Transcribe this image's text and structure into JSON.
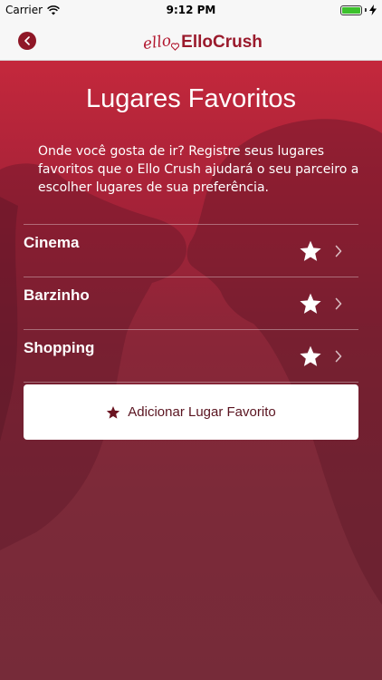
{
  "status_bar": {
    "carrier": "Carrier",
    "time": "9:12 PM"
  },
  "nav": {
    "logo_script": "ello",
    "logo_brand": "ElloCrush"
  },
  "page": {
    "title": "Lugares Favoritos",
    "description": "Onde você gosta de ir? Registre seus lugares favoritos que o Ello Crush ajudará o seu parceiro a escolher lugares de sua preferência."
  },
  "places": [
    {
      "label": "Cinema"
    },
    {
      "label": "Barzinho"
    },
    {
      "label": "Shopping"
    }
  ],
  "add_button": {
    "label": "Adicionar Lugar Favorito"
  },
  "colors": {
    "accent": "#8f1727",
    "background_top": "#c4283c",
    "background_bottom": "#762b39"
  }
}
